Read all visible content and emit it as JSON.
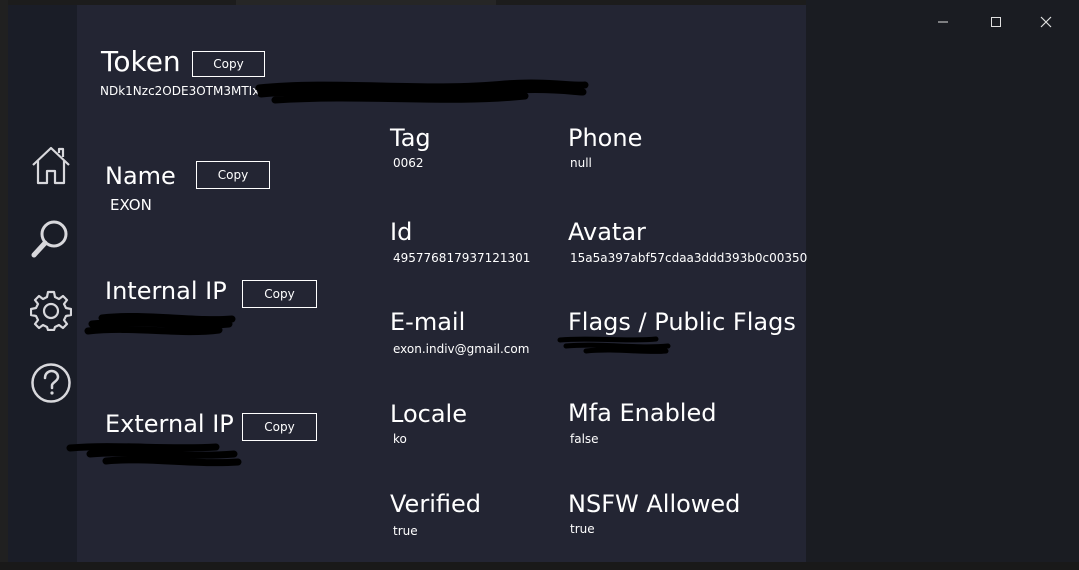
{
  "window": {
    "controls": {
      "minimize": "minimize-icon",
      "maximize": "maximize-icon",
      "close": "close-icon"
    }
  },
  "sidebar": {
    "items": [
      {
        "icon": "home-icon"
      },
      {
        "icon": "search-icon"
      },
      {
        "icon": "gear-icon"
      },
      {
        "icon": "help-icon"
      }
    ]
  },
  "token": {
    "label": "Token",
    "value": "NDk1Nzc2ODE3OTM3MTIx",
    "copy_label": "Copy"
  },
  "name": {
    "label": "Name",
    "value": "EXON",
    "copy_label": "Copy"
  },
  "internal_ip": {
    "label": "Internal IP",
    "copy_label": "Copy"
  },
  "external_ip": {
    "label": "External IP",
    "copy_label": "Copy"
  },
  "fields": {
    "tag": {
      "label": "Tag",
      "value": "0062"
    },
    "phone": {
      "label": "Phone",
      "value": "null"
    },
    "id": {
      "label": "Id",
      "value": "495776817937121301"
    },
    "avatar": {
      "label": "Avatar",
      "value": "15a5a397abf57cdaa3ddd393b0c00350"
    },
    "email": {
      "label": "E-mail",
      "value": "exon.indiv@gmail.com"
    },
    "flags": {
      "label": "Flags / Public Flags"
    },
    "locale": {
      "label": "Locale",
      "value": "ko"
    },
    "mfa": {
      "label": "Mfa Enabled",
      "value": "false"
    },
    "verified": {
      "label": "Verified",
      "value": "true"
    },
    "nsfw": {
      "label": "NSFW Allowed",
      "value": "true"
    }
  }
}
